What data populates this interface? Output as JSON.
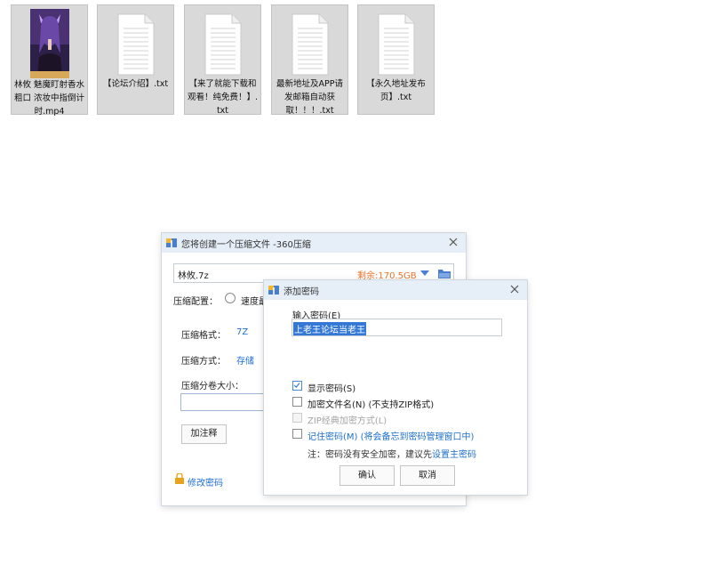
{
  "desktop": {
    "files": [
      {
        "name": "林攸 魅魔盯射香水粗口 浓妆中指倒计时.mp4",
        "type": "video"
      },
      {
        "name": "【论坛介绍】.txt",
        "type": "txt"
      },
      {
        "name": "【来了就能下载和观看！纯免费！】.txt",
        "type": "txt"
      },
      {
        "name": "最新地址及APP请发邮箱自动获取！！！.txt",
        "type": "txt"
      },
      {
        "name": "【永久地址发布页】.txt",
        "type": "txt"
      }
    ]
  },
  "compress_dialog": {
    "title": "您将创建一个压缩文件 -360压缩",
    "filename": "林攸.7z",
    "free_space": "剩余:170.5GB",
    "config_label": "压缩配置：",
    "config_option": "速度最",
    "format_label": "压缩格式：",
    "format_value": "7Z",
    "method_label": "压缩方式：",
    "method_value": "存储",
    "volume_label": "压缩分卷大小：",
    "volume_value": "",
    "add_comment_label": "加注释",
    "change_password_label": "修改密码",
    "colors": {
      "accent": "#1e6fd0",
      "free_space": "#e8762d",
      "lock": "#e8a21b"
    }
  },
  "password_dialog": {
    "title": "添加密码",
    "input_label": "输入密码(E)",
    "password_value": "上老王论坛当老王",
    "show_password_label": "显示密码(S)",
    "show_password_checked": true,
    "encrypt_filenames_label": "加密文件名(N) (不支持ZIP格式)",
    "encrypt_filenames_checked": false,
    "zip_classic_label": "ZIP经典加密方式(L)",
    "zip_classic_checked": false,
    "remember_label": "记住密码(M) (将会备忘到密码管理窗口中)",
    "remember_checked": false,
    "note_prefix": "注：密码没有安全加密，建议先",
    "note_link": "设置主密码",
    "ok_label": "确认",
    "cancel_label": "取消"
  }
}
